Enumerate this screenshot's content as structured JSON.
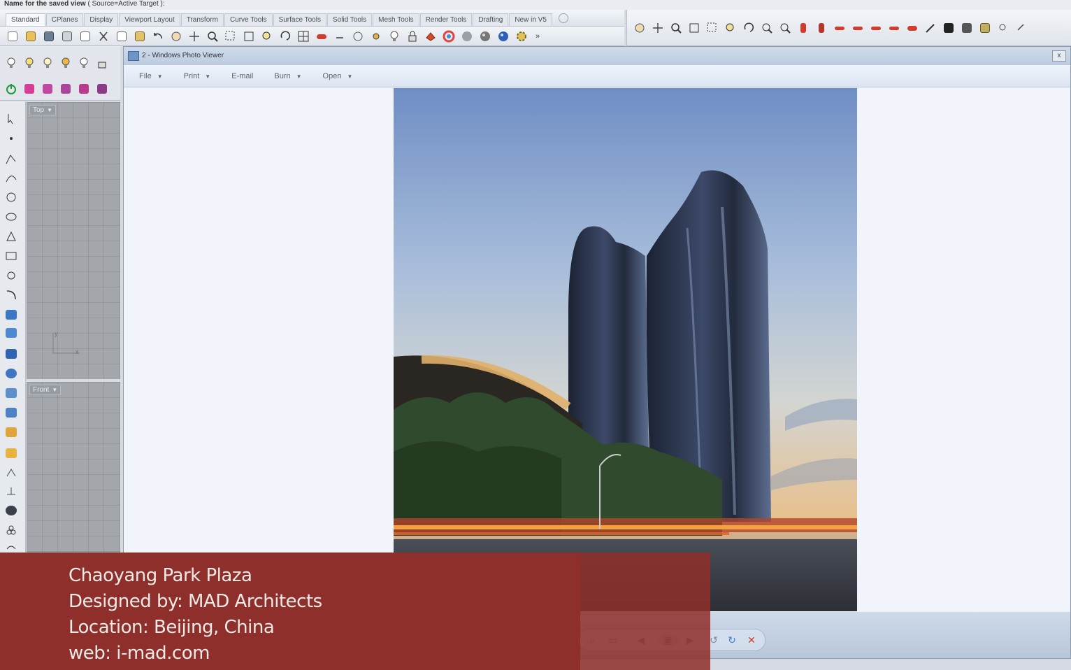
{
  "command_line": {
    "prompt": "Name for the saved view",
    "options": "( Source=Active  Target ):"
  },
  "tabs": [
    "Standard",
    "CPlanes",
    "Display",
    "Viewport Layout",
    "Transform",
    "Curve Tools",
    "Surface Tools",
    "Solid Tools",
    "Mesh Tools",
    "Render Tools",
    "Drafting",
    "New in V5"
  ],
  "toolbar_overflow": "»",
  "viewports": {
    "top_label": "Top",
    "front_label": "Front",
    "axis_x": "x",
    "axis_y": "y"
  },
  "photo_viewer": {
    "title": "2 - Windows Photo Viewer",
    "menus": [
      "File",
      "Print",
      "E-mail",
      "Burn",
      "Open"
    ],
    "close_label": "x"
  },
  "caption": {
    "line1": "Chaoyang Park Plaza",
    "line2": "Designed by: MAD Architects",
    "line3": "Location: Beijing, China",
    "line4": "web: i-mad.com"
  },
  "colors": {
    "caption_bg": "#8f2f2b",
    "viewer_bg": "#f1f4fa",
    "viewport_grey": "#a3a7ab"
  }
}
